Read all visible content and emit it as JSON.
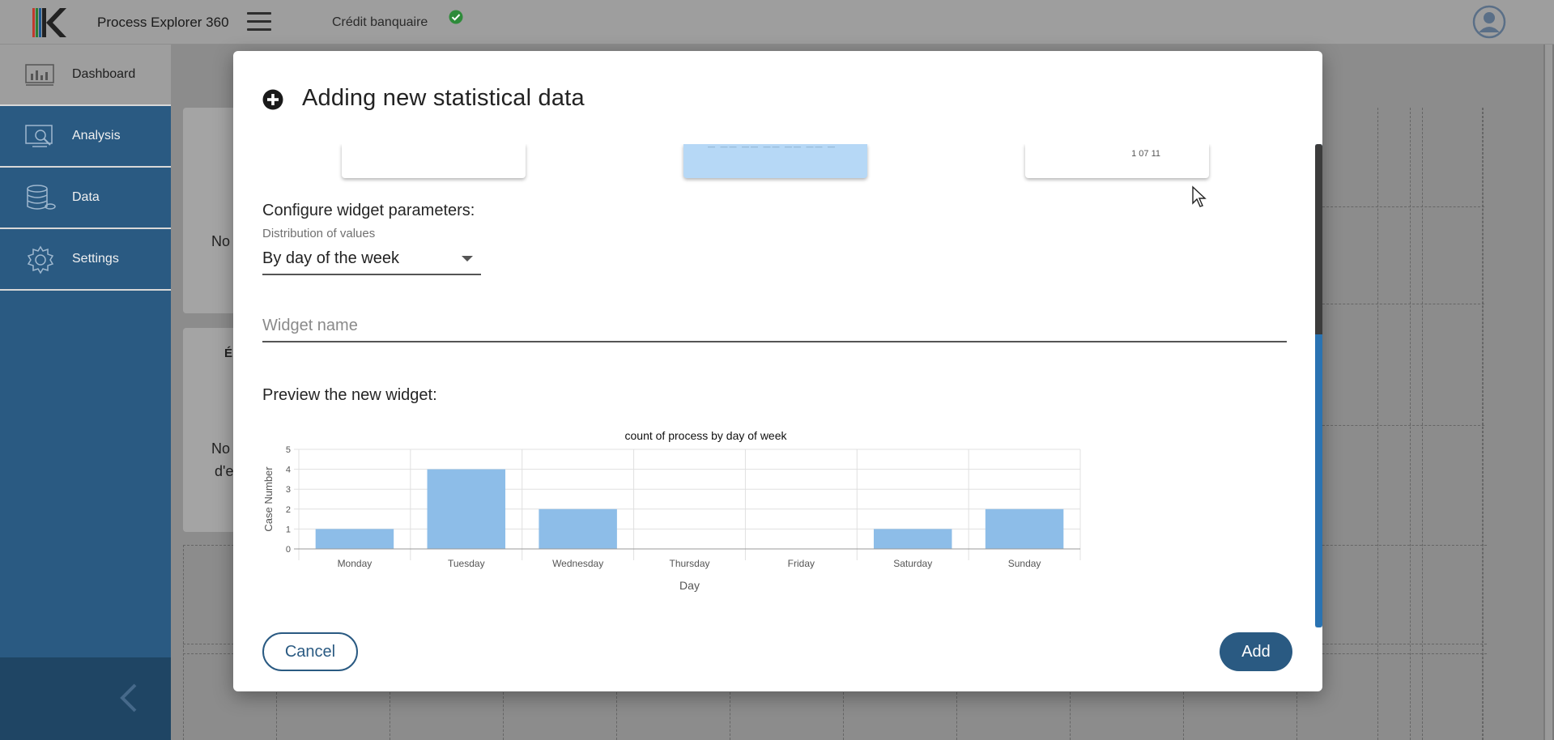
{
  "app": {
    "title": "Process Explorer 360",
    "project_name": "Crédit banquaire",
    "project_status_icon": "check-circle-icon",
    "user_icon": "user-avatar-icon",
    "accent_color": "#2a5a82"
  },
  "sidebar": {
    "items": [
      {
        "label": "Dashboard",
        "icon": "dashboard-icon",
        "active": true
      },
      {
        "label": "Analysis",
        "icon": "analysis-icon",
        "active": false
      },
      {
        "label": "Data",
        "icon": "database-icon",
        "active": false
      },
      {
        "label": "Settings",
        "icon": "gear-icon",
        "active": false
      }
    ],
    "collapse_icon": "chevron-left-icon"
  },
  "background": {
    "card1_text": "No",
    "card2_heading": "É",
    "card2_line1": "No",
    "card2_line2": "d'e"
  },
  "modal": {
    "title": "Adding new statistical data",
    "title_icon": "add-circle-icon",
    "thumbnail_third_text": "1 07 11",
    "configure_label": "Configure widget parameters:",
    "distribution_caption": "Distribution of values",
    "distribution_value": "By day of the week",
    "widget_name_value": "",
    "widget_name_placeholder": "Widget name",
    "preview_label": "Preview the new widget:",
    "cancel_label": "Cancel",
    "add_label": "Add"
  },
  "chart_data": {
    "type": "bar",
    "title": "count of process by day of week",
    "xlabel": "Day",
    "ylabel": "Case Number",
    "categories": [
      "Monday",
      "Tuesday",
      "Wednesday",
      "Thursday",
      "Friday",
      "Saturday",
      "Sunday"
    ],
    "values": [
      1,
      4,
      2,
      0,
      0,
      1,
      2
    ],
    "ylim": [
      0,
      5
    ],
    "yticks": [
      0,
      1,
      2,
      3,
      4,
      5
    ],
    "grid": true,
    "bar_color": "#8dbde8"
  }
}
